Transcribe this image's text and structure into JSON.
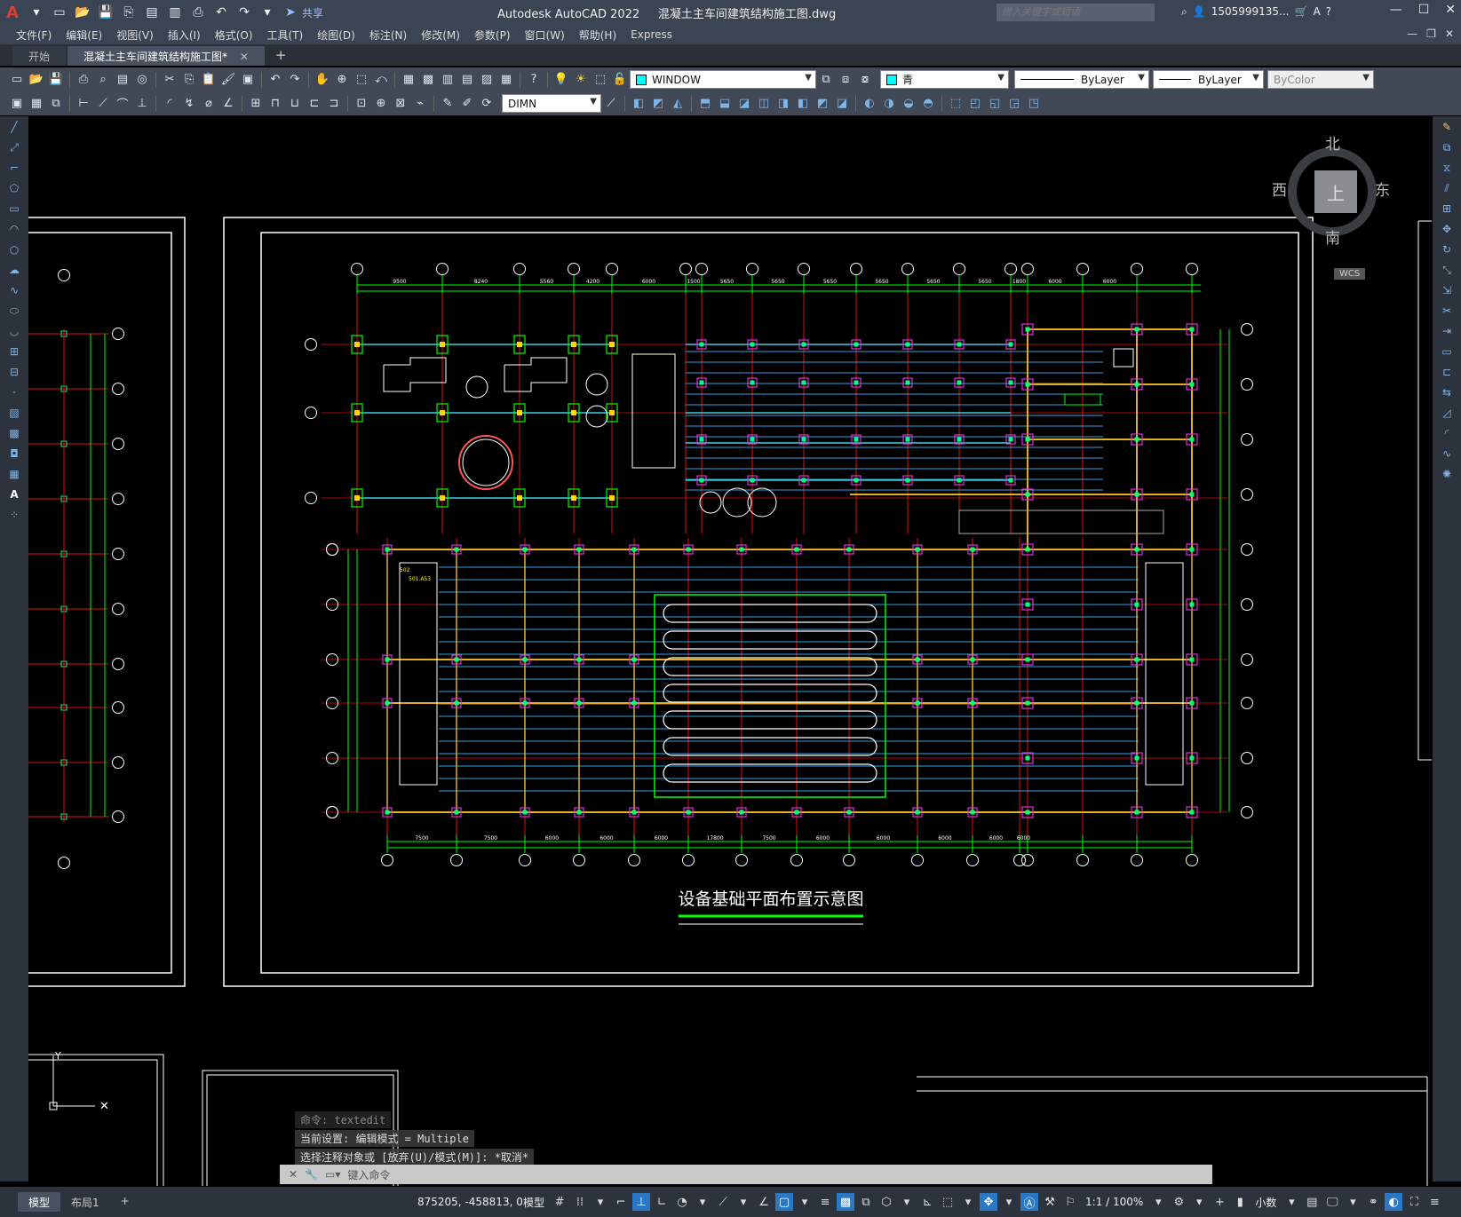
{
  "app": {
    "product": "Autodesk AutoCAD 2022",
    "filename": "混凝土主车间建筑结构施工图.dwg",
    "search_placeholder": "键入关键字或短语",
    "username": "1505999135...",
    "share_label": "共享"
  },
  "menu": [
    "文件(F)",
    "编辑(E)",
    "视图(V)",
    "插入(I)",
    "格式(O)",
    "工具(T)",
    "绘图(D)",
    "标注(N)",
    "修改(M)",
    "参数(P)",
    "窗口(W)",
    "帮助(H)",
    "Express"
  ],
  "tabs": {
    "start": "开始",
    "active": "混凝土主车间建筑结构施工图*",
    "close": "✕",
    "add": "+"
  },
  "toolbar": {
    "layer_state": "WINDOW",
    "color": "青",
    "linetype": "ByLayer",
    "lineweight": "ByLayer",
    "plotstyle": "ByColor",
    "dimstyle": "DIMN"
  },
  "colors": {
    "layer_swatch": "#00ffff",
    "accent": "#2a78c4"
  },
  "viewcube": {
    "north": "北",
    "south": "南",
    "east": "东",
    "west": "西",
    "face": "上",
    "wcs": "WCS"
  },
  "drawing": {
    "title": "设备基础平面布置示意图",
    "top_dims": [
      "9500",
      "8240",
      "5560",
      "4200",
      "6000",
      "1500",
      "5650",
      "5650",
      "5650",
      "5650",
      "5650",
      "5650",
      "1800",
      "6000",
      "6000"
    ],
    "bottom_dims": [
      "7500",
      "7500",
      "6000",
      "6000",
      "6000",
      "17800",
      "7500",
      "6000",
      "6000",
      "6000",
      "6000",
      "6000"
    ],
    "labels": [
      "501.A53",
      "502"
    ]
  },
  "command": {
    "history": [
      "命令:  textedit",
      "当前设置: 编辑模式 = Multiple",
      "选择注释对象或 [放弃(U)/模式(M)]: *取消*"
    ],
    "input_placeholder": "键入命令"
  },
  "status": {
    "layouts": [
      "模型",
      "布局1"
    ],
    "add": "+",
    "coords": "875205, -458813, 0",
    "space": "模型",
    "scale": "1:1 / 100%",
    "units": "小数"
  }
}
